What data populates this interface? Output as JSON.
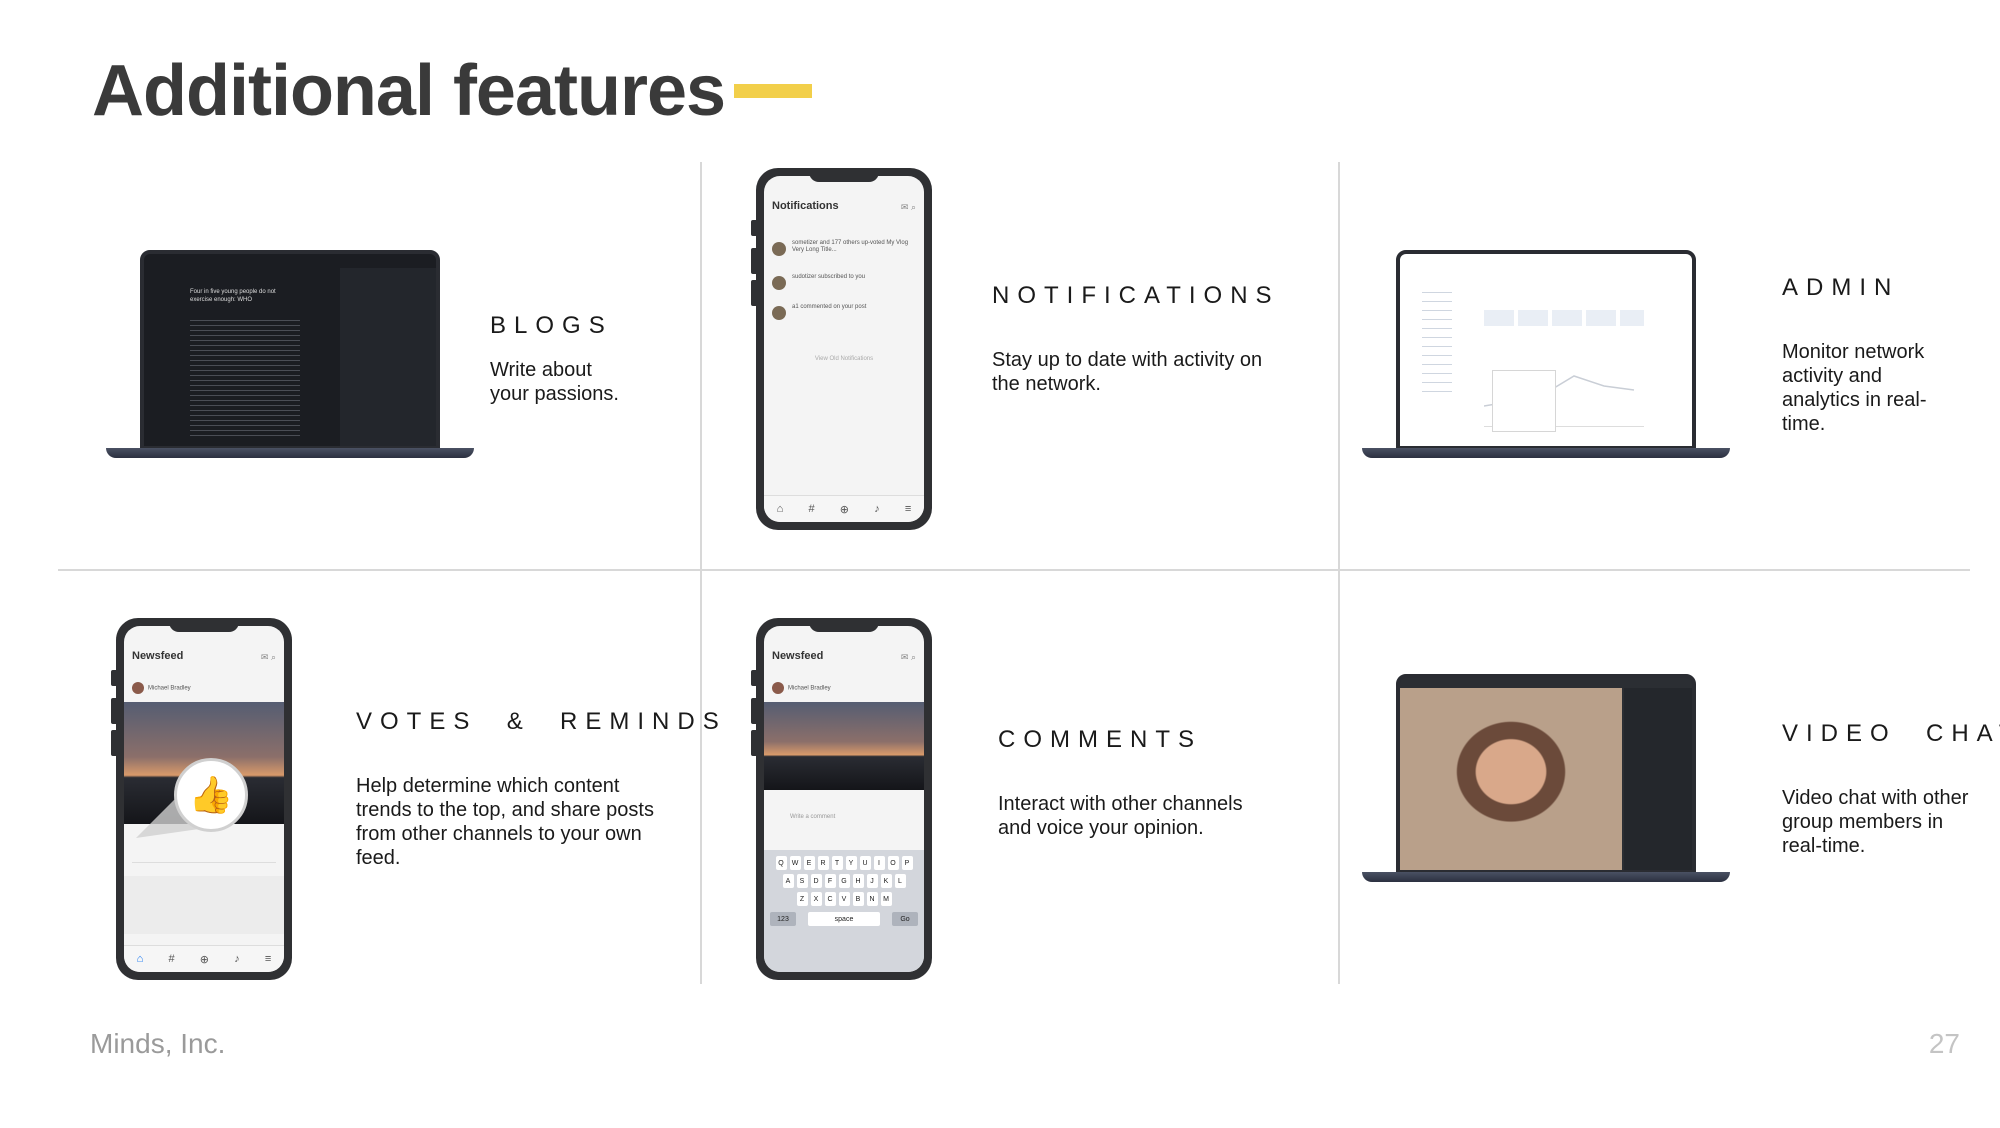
{
  "title": "Additional features",
  "footer": {
    "brand": "Minds, Inc.",
    "page": "27"
  },
  "features": {
    "blogs": {
      "label": "BLOGS",
      "desc": "Write about your passions."
    },
    "notifications": {
      "label": "NOTIFICATIONS",
      "desc": "Stay up to date with activity on the network."
    },
    "admin": {
      "label": "ADMIN",
      "desc": "Monitor network activity and analytics in real-time."
    },
    "votes": {
      "label": "VOTES  &  REMINDS",
      "desc": "Help determine which content trends to the top, and share posts from other channels to your own feed."
    },
    "comments": {
      "label": "COMMENTS",
      "desc": "Interact with other channels and voice your opinion."
    },
    "video": {
      "label": "VIDEO  CHAT",
      "desc": "Video chat with other group members in real-time."
    }
  },
  "devices": {
    "blog_screen": {
      "headline": "Four in five young people do not exercise enough: WHO"
    },
    "notifications_screen": {
      "title": "Notifications",
      "items": [
        "sometizer and 177 others up-voted My Vlog Very Long Title...",
        "sudotizer subscribed to you",
        "a1 commented on your post"
      ],
      "view_old": "View Old Notifications"
    },
    "newsfeed_screen": {
      "title": "Newsfeed",
      "user": "Michael Bradley",
      "comment_placeholder": "Write a comment"
    },
    "keyboard": {
      "row1": [
        "Q",
        "W",
        "E",
        "R",
        "T",
        "Y",
        "U",
        "I",
        "O",
        "P"
      ],
      "row2": [
        "A",
        "S",
        "D",
        "F",
        "G",
        "H",
        "J",
        "K",
        "L"
      ],
      "row3": [
        "Z",
        "X",
        "C",
        "V",
        "B",
        "N",
        "M"
      ],
      "space": "space",
      "go": "Go",
      "num": "123"
    }
  },
  "colors": {
    "accent": "#f2cf4a",
    "divider": "#d8d8d8",
    "like_blue": "#1877f2"
  }
}
